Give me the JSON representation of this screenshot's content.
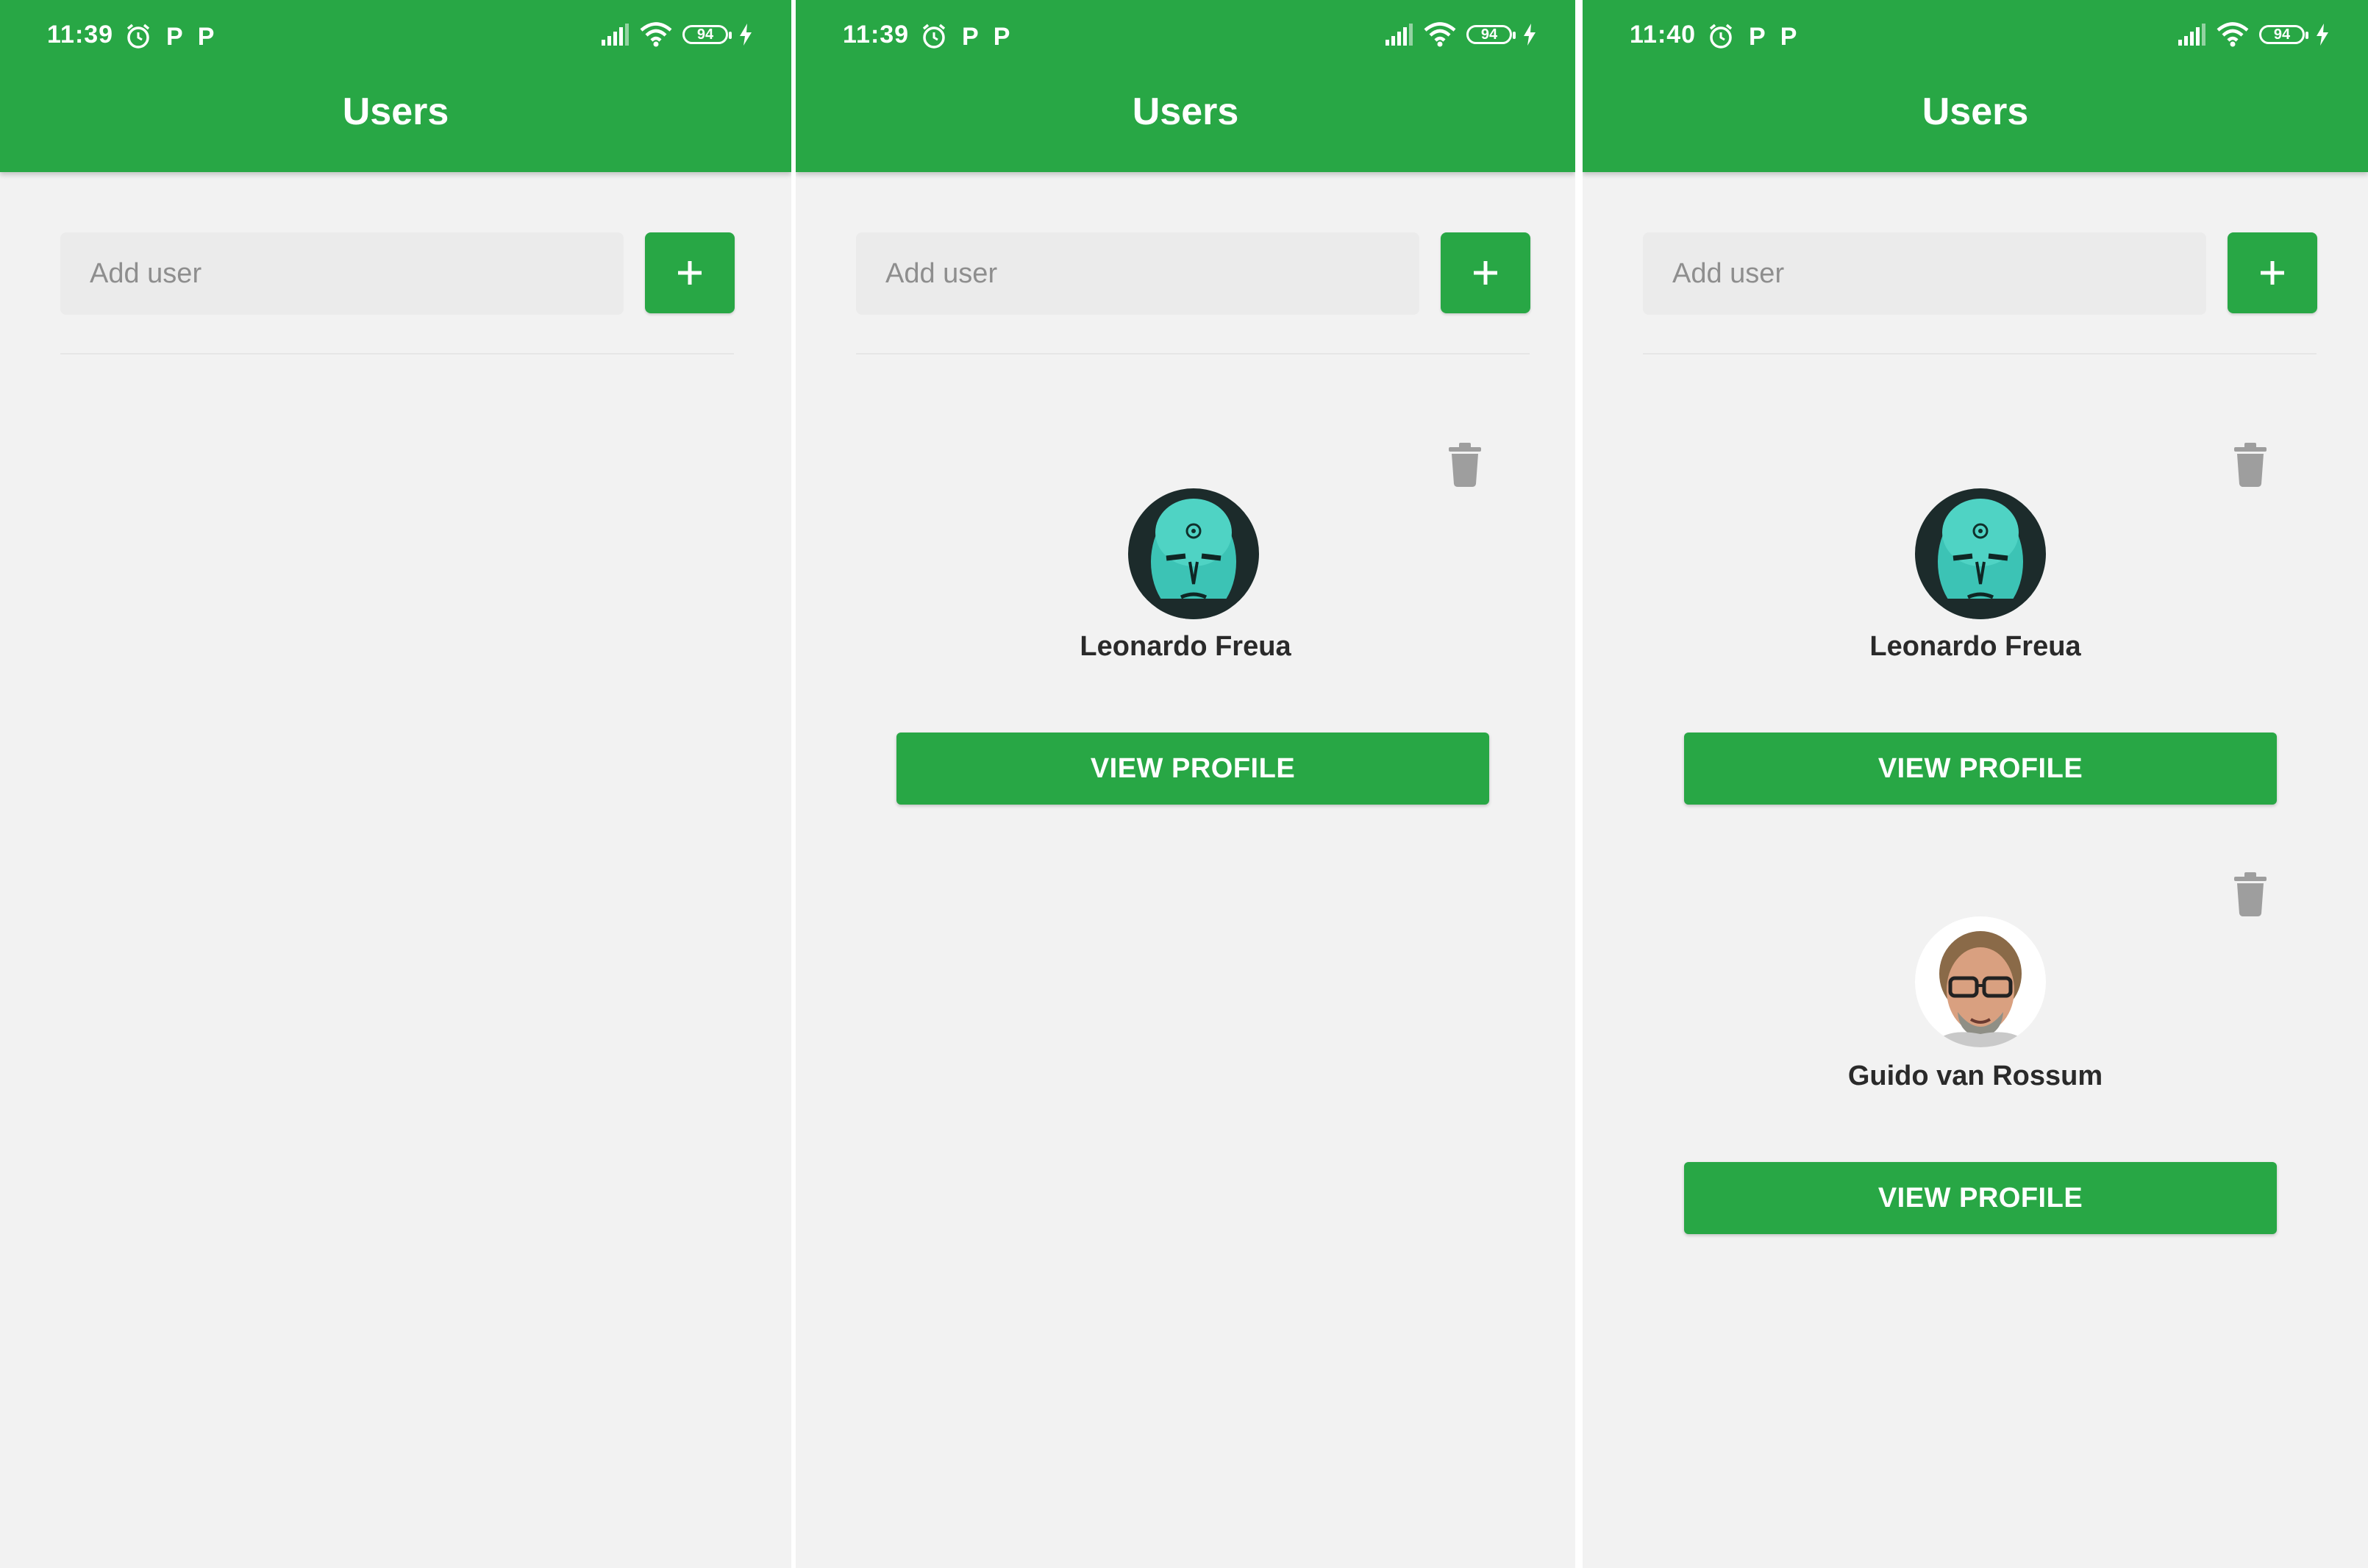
{
  "colors": {
    "primary": "#28a745",
    "background": "#f2f2f2",
    "icon_gray": "#9e9e9e"
  },
  "screens": [
    {
      "status": {
        "time": "11:39",
        "battery": "94"
      },
      "title": "Users",
      "input": {
        "placeholder": "Add user",
        "value": ""
      },
      "add_button_icon": "plus-icon",
      "users": []
    },
    {
      "status": {
        "time": "11:39",
        "battery": "94"
      },
      "title": "Users",
      "input": {
        "placeholder": "Add user",
        "value": ""
      },
      "add_button_icon": "plus-icon",
      "users": [
        {
          "name": "Leonardo Freua",
          "avatar": "teal-face-avatar",
          "button": "VIEW PROFILE",
          "delete_icon": "trash-icon"
        }
      ]
    },
    {
      "status": {
        "time": "11:40",
        "battery": "94"
      },
      "title": "Users",
      "input": {
        "placeholder": "Add user",
        "value": ""
      },
      "add_button_icon": "plus-icon",
      "users": [
        {
          "name": "Leonardo Freua",
          "avatar": "teal-face-avatar",
          "button": "VIEW PROFILE",
          "delete_icon": "trash-icon"
        },
        {
          "name": "Guido van Rossum",
          "avatar": "man-with-glasses-avatar",
          "button": "VIEW PROFILE",
          "delete_icon": "trash-icon"
        }
      ]
    }
  ]
}
